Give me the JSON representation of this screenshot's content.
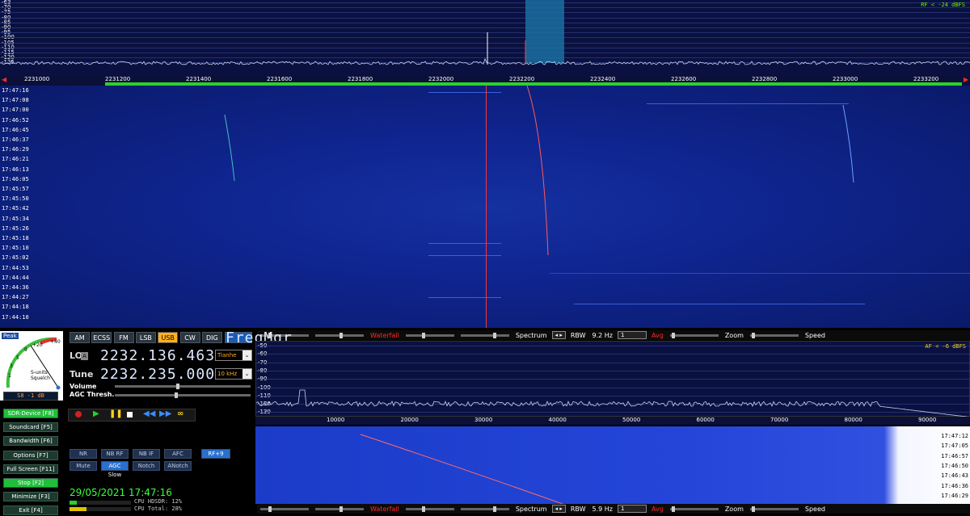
{
  "rf_spectrum": {
    "db_labels": [
      "-63",
      "-70",
      "-75",
      "-80",
      "-85",
      "-90",
      "-95",
      "-100",
      "-105",
      "-110",
      "-115",
      "-120",
      "-125"
    ],
    "level_text": "RF < -24 dBFS",
    "freq_ticks": [
      "2231000",
      "2231200",
      "2231400",
      "2231600",
      "2231800",
      "2232000",
      "2232200",
      "2232400",
      "2232600",
      "2232800",
      "2233000",
      "2233200"
    ]
  },
  "waterfall": {
    "time_labels": [
      "17:47:16",
      "17:47:08",
      "17:47:00",
      "17:46:52",
      "17:46:45",
      "17:46:37",
      "17:46:29",
      "17:46:21",
      "17:46:13",
      "17:46:05",
      "17:45:57",
      "17:45:50",
      "17:45:42",
      "17:45:34",
      "17:45:26",
      "17:45:18",
      "17:45:10",
      "17:45:02",
      "17:44:53",
      "17:44:44",
      "17:44:36",
      "17:44:27",
      "17:44:18",
      "17:44:10"
    ]
  },
  "rf_toolbar": {
    "waterfall_label": "Waterfall",
    "spectrum_label": "Spectrum",
    "rbw_label": "RBW",
    "rbw_value": "9.2 Hz",
    "avg_value": "1",
    "avg_label": "Avg",
    "zoom_label": "Zoom",
    "speed_label": "Speed"
  },
  "smeter": {
    "peak_label": "Peak",
    "scale_labels": [
      "+40",
      "+20",
      "9",
      "5",
      "3",
      "1"
    ],
    "unit_label": "S-units",
    "squelch_label": "Squelch",
    "reading": "S8 -1 dB"
  },
  "modes": [
    "AM",
    "ECSS",
    "FM",
    "LSB",
    "USB",
    "CW",
    "DIG"
  ],
  "active_mode": "USB",
  "freqmgr_label": "FreqMgr",
  "lo": {
    "label": "LO",
    "badge": "A",
    "value": "2232.136.463",
    "preset": "Tianhe"
  },
  "tune": {
    "label": "Tune",
    "value": "2232.235.000",
    "step": "10 kHz"
  },
  "volume_label": "Volume",
  "agc_thresh_label": "AGC Thresh.",
  "function_buttons": [
    "SDR-Device [F8]",
    "Soundcard [F5]",
    "Bandwidth [F6]",
    "Options [F7]",
    "Full Screen [F11]",
    "Stop [F2]",
    "Minimize [F3]",
    "Exit [F4]"
  ],
  "dsp_row1": [
    "NR",
    "NB RF",
    "NB IF",
    "AFC"
  ],
  "dsp_row2": [
    "Mute",
    "AGC Slow",
    "Notch",
    "ANotch"
  ],
  "rf_gain_label": "RF+9",
  "datetime": "29/05/2021 17:47:16",
  "cpu_hdsdr": "CPU HDSDR: 12%",
  "cpu_total": "CPU Total: 28%",
  "af_spectrum": {
    "db_labels": [
      "-50",
      "-60",
      "-70",
      "-80",
      "-90",
      "-100",
      "-110",
      "-120",
      "-130"
    ],
    "level_text": "AF < -6 dBFS",
    "freq_ticks": [
      "10000",
      "20000",
      "30000",
      "40000",
      "50000",
      "60000",
      "70000",
      "80000",
      "90000"
    ]
  },
  "af_waterfall": {
    "time_labels": [
      "17:47:12",
      "17:47:05",
      "17:46:57",
      "17:46:50",
      "17:46:43",
      "17:46:36",
      "17:46:29"
    ]
  },
  "af_toolbar": {
    "waterfall_label": "Waterfall",
    "spectrum_label": "Spectrum",
    "rbw_label": "RBW",
    "rbw_value": "5.9 Hz",
    "avg_value": "1",
    "avg_label": "Avg",
    "zoom_label": "Zoom",
    "speed_label": "Speed"
  },
  "colors": {
    "spectrum_bg": "#0a1140",
    "waterfall_blue": "#1530a0",
    "carrier_red": "#ff3333",
    "mode_active": "#ffb01c",
    "fn_on": "#1fbf3a",
    "datetime_green": "#3cff3c"
  }
}
